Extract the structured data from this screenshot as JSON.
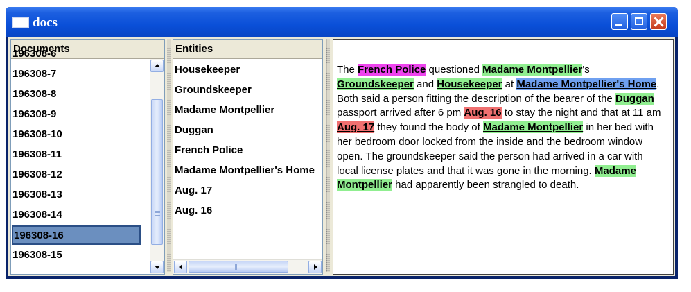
{
  "window": {
    "title": "docs"
  },
  "documents": {
    "header": "Documents",
    "items": [
      "196308-6",
      "196308-7",
      "196308-8",
      "196308-9",
      "196308-10",
      "196308-11",
      "196308-12",
      "196308-13",
      "196308-14",
      "196308-16",
      "196308-15"
    ],
    "selected": "196308-16"
  },
  "entities": {
    "header": "Entities",
    "items": [
      "Housekeeper",
      "Groundskeeper",
      "Madame Montpellier",
      "Duggan",
      "French Police",
      "Madame Montpellier's Home",
      "Aug. 17",
      "Aug. 16"
    ]
  },
  "document_text": {
    "segments": [
      {
        "text": "The ",
        "type": "plain"
      },
      {
        "text": "French Police",
        "type": "organization",
        "color": "#ee44ee"
      },
      {
        "text": " questioned ",
        "type": "plain"
      },
      {
        "text": "Madame Montpellier",
        "type": "person",
        "color": "#90ee90"
      },
      {
        "text": "'s ",
        "type": "plain"
      },
      {
        "text": "Groundskeeper",
        "type": "person",
        "color": "#90ee90"
      },
      {
        "text": " and ",
        "type": "plain"
      },
      {
        "text": "Housekeeper",
        "type": "person",
        "color": "#90ee90"
      },
      {
        "text": " at ",
        "type": "plain"
      },
      {
        "text": "Madame Montpellier's Home",
        "type": "location",
        "color": "#6fa0f0"
      },
      {
        "text": ". Both said a person fitting the description of the bearer of the ",
        "type": "plain"
      },
      {
        "text": "Duggan",
        "type": "person",
        "color": "#90ee90"
      },
      {
        "text": " passport arrived after 6 pm ",
        "type": "plain"
      },
      {
        "text": "Aug. 16",
        "type": "date",
        "color": "#f07070"
      },
      {
        "text": " to stay the night and that at 11 am ",
        "type": "plain"
      },
      {
        "text": "Aug. 17",
        "type": "date",
        "color": "#f07070"
      },
      {
        "text": " they found the body of ",
        "type": "plain"
      },
      {
        "text": "Madame Montpellier",
        "type": "person",
        "color": "#90ee90"
      },
      {
        "text": " in her bed with her bedroom door locked from the inside and the bedroom window open. The groundskeeper said the person had arrived in a car with local license plates and that it was gone in the morning.  ",
        "type": "plain"
      },
      {
        "text": "Madame Montpellier",
        "type": "person",
        "color": "#90ee90"
      },
      {
        "text": " had apparently been strangled to death.",
        "type": "plain"
      }
    ]
  }
}
